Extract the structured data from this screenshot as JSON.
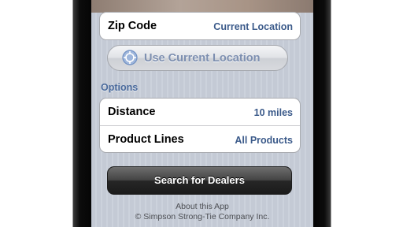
{
  "location_group": {
    "zip_label": "Zip Code",
    "zip_value": "Current Location"
  },
  "use_location_button": {
    "label": "Use Current Location",
    "icon": "crosshair-icon"
  },
  "options": {
    "header": "Options",
    "distance_label": "Distance",
    "distance_value": "10 miles",
    "product_lines_label": "Product Lines",
    "product_lines_value": "All Products"
  },
  "search_button": {
    "label": "Search for Dealers"
  },
  "footer": {
    "about": "About this App",
    "copyright": "© Simpson Strong-Tie Company Inc."
  },
  "colors": {
    "value_text": "#3b5a8a",
    "section_header": "#4a6a9c",
    "search_button": "#262626"
  }
}
